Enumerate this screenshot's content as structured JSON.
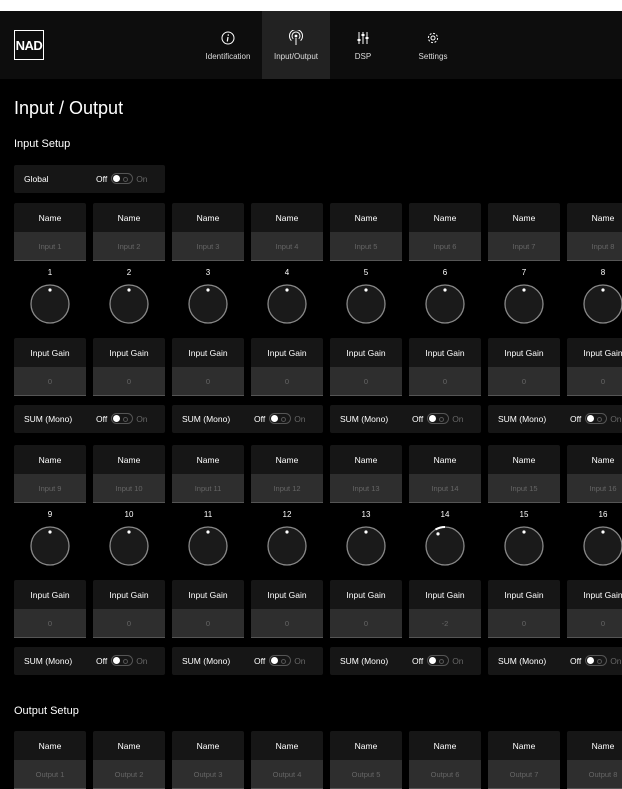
{
  "app": {
    "logo": "NAD"
  },
  "nav": {
    "tabs": [
      {
        "label": "Identification",
        "icon": "info-icon",
        "active": false
      },
      {
        "label": "Input/Output",
        "icon": "broadcast-icon",
        "active": true
      },
      {
        "label": "DSP",
        "icon": "sliders-icon",
        "active": false
      },
      {
        "label": "Settings",
        "icon": "gear-icon",
        "active": false
      }
    ]
  },
  "page": {
    "title": "Input / Output"
  },
  "input_setup": {
    "heading": "Input Setup",
    "global": {
      "label": "Global",
      "off": "Off",
      "on": "On",
      "state": "off"
    },
    "name_label": "Name",
    "gain_label": "Input Gain",
    "sum_label": "SUM (Mono)",
    "off": "Off",
    "on": "On",
    "rows": [
      {
        "channels": [
          {
            "number": "1",
            "name": "Input 1",
            "gain": "0",
            "knob": 0
          },
          {
            "number": "2",
            "name": "Input 2",
            "gain": "0",
            "knob": 0
          },
          {
            "number": "3",
            "name": "Input 3",
            "gain": "0",
            "knob": 0
          },
          {
            "number": "4",
            "name": "Input 4",
            "gain": "0",
            "knob": 0
          },
          {
            "number": "5",
            "name": "Input 5",
            "gain": "0",
            "knob": 0
          },
          {
            "number": "6",
            "name": "Input 6",
            "gain": "0",
            "knob": 0
          },
          {
            "number": "7",
            "name": "Input 7",
            "gain": "0",
            "knob": 0
          },
          {
            "number": "8",
            "name": "Input 8",
            "gain": "0",
            "knob": 0
          }
        ]
      },
      {
        "channels": [
          {
            "number": "9",
            "name": "Input 9",
            "gain": "0",
            "knob": 0
          },
          {
            "number": "10",
            "name": "Input 10",
            "gain": "0",
            "knob": 0
          },
          {
            "number": "11",
            "name": "Input 11",
            "gain": "0",
            "knob": 0
          },
          {
            "number": "12",
            "name": "Input 12",
            "gain": "0",
            "knob": 0
          },
          {
            "number": "13",
            "name": "Input 13",
            "gain": "0",
            "knob": 0
          },
          {
            "number": "14",
            "name": "Input 14",
            "gain": "-2",
            "knob": -2
          },
          {
            "number": "15",
            "name": "Input 15",
            "gain": "0",
            "knob": 0
          },
          {
            "number": "16",
            "name": "Input 16",
            "gain": "0",
            "knob": 0
          }
        ]
      }
    ]
  },
  "output_setup": {
    "heading": "Output Setup",
    "name_label": "Name",
    "outputs": [
      "Output 1",
      "Output 2",
      "Output 3",
      "Output 4",
      "Output 5",
      "Output 6",
      "Output 7",
      "Output 8"
    ]
  },
  "colors": {
    "background": "#000000",
    "panel": "#161616",
    "field": "#2e2e2e",
    "nav": "#0d0d0d",
    "active_tab": "#222222"
  }
}
